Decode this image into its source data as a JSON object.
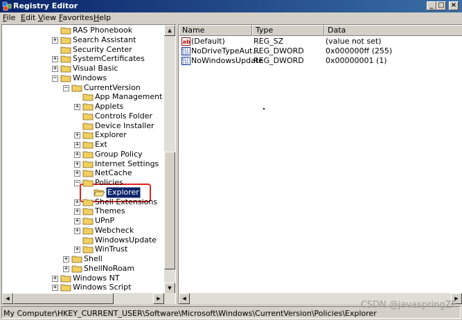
{
  "window": {
    "title": "Registry Editor"
  },
  "menu": [
    {
      "label": "File",
      "u": "F",
      "rest": "ile"
    },
    {
      "label": "Edit",
      "u": "E",
      "rest": "dit"
    },
    {
      "label": "View",
      "u": "V",
      "rest": "iew"
    },
    {
      "label": "Favorites",
      "u": "F",
      "rest": "avorites"
    },
    {
      "label": "Help",
      "u": "H",
      "rest": "elp"
    }
  ],
  "tree": [
    {
      "label": "RAS Phonebook",
      "level": 0,
      "expander": ""
    },
    {
      "label": "Search Assistant",
      "level": 0,
      "expander": "+"
    },
    {
      "label": "Security Center",
      "level": 0,
      "expander": ""
    },
    {
      "label": "SystemCertificates",
      "level": 0,
      "expander": "+"
    },
    {
      "label": "Visual Basic",
      "level": 0,
      "expander": "+"
    },
    {
      "label": "Windows",
      "level": 0,
      "expander": "-"
    },
    {
      "label": "CurrentVersion",
      "level": 1,
      "expander": "-"
    },
    {
      "label": "App Management",
      "level": 2,
      "expander": ""
    },
    {
      "label": "Applets",
      "level": 2,
      "expander": "+"
    },
    {
      "label": "Controls Folder",
      "level": 2,
      "expander": ""
    },
    {
      "label": "Device Installer",
      "level": 2,
      "expander": ""
    },
    {
      "label": "Explorer",
      "level": 2,
      "expander": "+"
    },
    {
      "label": "Ext",
      "level": 2,
      "expander": "+"
    },
    {
      "label": "Group Policy",
      "level": 2,
      "expander": "+"
    },
    {
      "label": "Internet Settings",
      "level": 2,
      "expander": "+"
    },
    {
      "label": "NetCache",
      "level": 2,
      "expander": "+"
    },
    {
      "label": "Policies",
      "level": 2,
      "expander": "-"
    },
    {
      "label": "Explorer",
      "level": 3,
      "expander": "",
      "selected": true
    },
    {
      "label": "Shell Extensions",
      "level": 2,
      "expander": "+"
    },
    {
      "label": "Themes",
      "level": 2,
      "expander": "+"
    },
    {
      "label": "UPnP",
      "level": 2,
      "expander": "+"
    },
    {
      "label": "Webcheck",
      "level": 2,
      "expander": "+"
    },
    {
      "label": "WindowsUpdate",
      "level": 2,
      "expander": ""
    },
    {
      "label": "WinTrust",
      "level": 2,
      "expander": "+"
    },
    {
      "label": "Shell",
      "level": 1,
      "expander": "+"
    },
    {
      "label": "ShellNoRoam",
      "level": 1,
      "expander": "+"
    },
    {
      "label": "Windows NT",
      "level": 0,
      "expander": "+"
    },
    {
      "label": "Windows Script",
      "level": 0,
      "expander": "+"
    }
  ],
  "list": {
    "headers": [
      "Name",
      "Type",
      "Data"
    ],
    "rows": [
      {
        "name": "(Default)",
        "type": "REG_SZ",
        "data": "(value not set)",
        "icon": "string-value-icon"
      },
      {
        "name": "NoDriveTypeAut...",
        "type": "REG_DWORD",
        "data": "0x000000ff (255)",
        "icon": "binary-value-icon"
      },
      {
        "name": "NoWindowsUpdate",
        "type": "REG_DWORD",
        "data": "0x00000001 (1)",
        "icon": "binary-value-icon"
      }
    ]
  },
  "status": {
    "path": "My Computer\\HKEY_CURRENT_USER\\Software\\Microsoft\\Windows\\CurrentVersion\\Policies\\Explorer"
  },
  "watermark": "CSDN @javaspringZF",
  "colors": {
    "title_start": "#0a246a",
    "title_end": "#3a6ea5",
    "folder": "#f0d060",
    "highlight": "#e0201c"
  }
}
